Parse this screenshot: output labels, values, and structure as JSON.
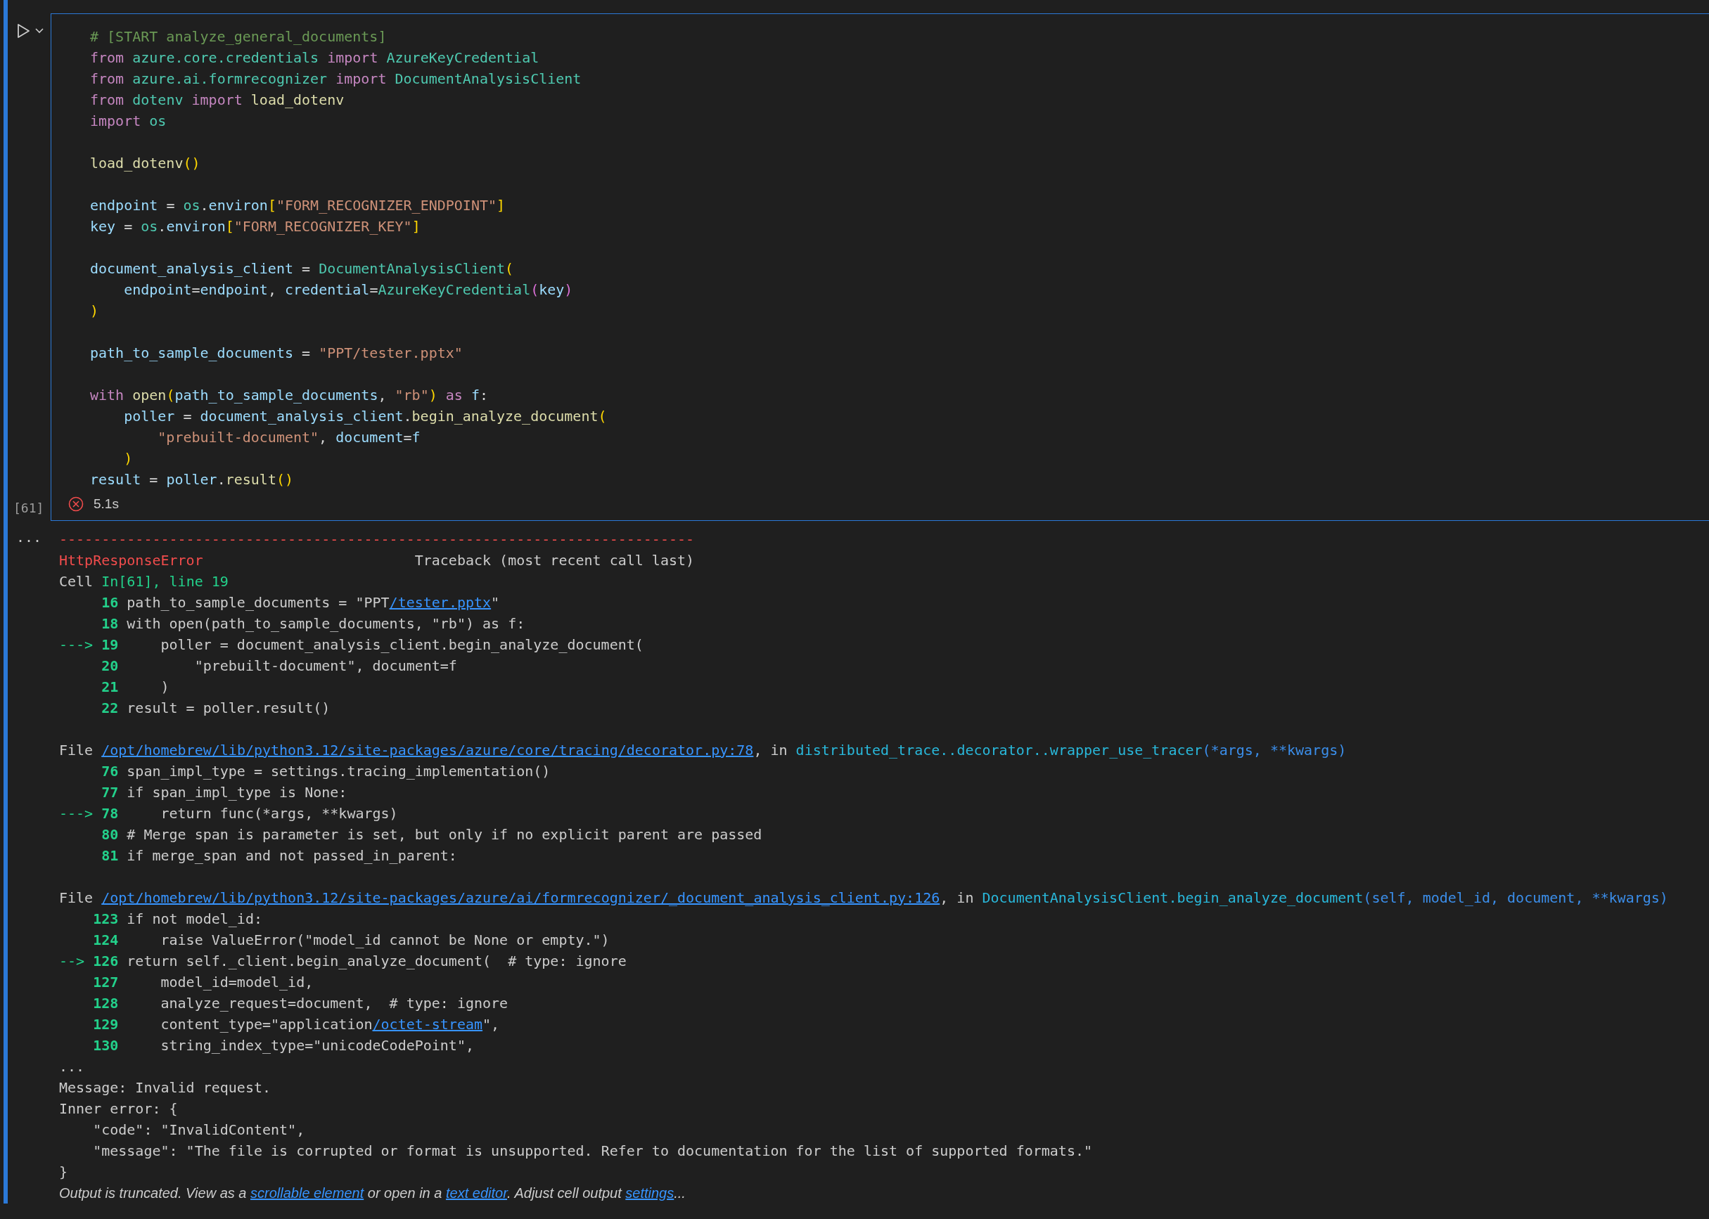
{
  "cell": {
    "execution_count": "[61]",
    "failed": true,
    "duration": "5.1s",
    "code_blocks": [
      [
        [
          {
            "kind": "comment",
            "text": "# [START analyze_general_documents]"
          }
        ],
        [
          {
            "kind": "kw",
            "text": "from "
          },
          {
            "kind": "mod",
            "text": "azure.core.credentials "
          },
          {
            "kind": "kw",
            "text": "import "
          },
          {
            "kind": "cls",
            "text": "AzureKeyCredential"
          }
        ],
        [
          {
            "kind": "kw",
            "text": "from "
          },
          {
            "kind": "mod",
            "text": "azure.ai.formrecognizer "
          },
          {
            "kind": "kw",
            "text": "import "
          },
          {
            "kind": "cls",
            "text": "DocumentAnalysisClient"
          }
        ],
        [
          {
            "kind": "kw",
            "text": "from "
          },
          {
            "kind": "mod",
            "text": "dotenv "
          },
          {
            "kind": "kw",
            "text": "import "
          },
          {
            "kind": "fn",
            "text": "load_dotenv"
          }
        ],
        [
          {
            "kind": "kw",
            "text": "import "
          },
          {
            "kind": "mod",
            "text": "os"
          }
        ]
      ],
      [
        [
          {
            "kind": "fn",
            "text": "load_dotenv"
          },
          {
            "kind": "br",
            "text": "()"
          }
        ]
      ],
      [
        [
          {
            "kind": "var",
            "text": "endpoint "
          },
          {
            "kind": "p",
            "text": "= "
          },
          {
            "kind": "mod",
            "text": "os"
          },
          {
            "kind": "p",
            "text": "."
          },
          {
            "kind": "var",
            "text": "environ"
          },
          {
            "kind": "br",
            "text": "["
          },
          {
            "kind": "str",
            "text": "\"FORM_RECOGNIZER_ENDPOINT\""
          },
          {
            "kind": "br",
            "text": "]"
          }
        ],
        [
          {
            "kind": "var",
            "text": "key "
          },
          {
            "kind": "p",
            "text": "= "
          },
          {
            "kind": "mod",
            "text": "os"
          },
          {
            "kind": "p",
            "text": "."
          },
          {
            "kind": "var",
            "text": "environ"
          },
          {
            "kind": "br",
            "text": "["
          },
          {
            "kind": "str",
            "text": "\"FORM_RECOGNIZER_KEY\""
          },
          {
            "kind": "br",
            "text": "]"
          }
        ]
      ],
      [
        [
          {
            "kind": "var",
            "text": "document_analysis_client "
          },
          {
            "kind": "p",
            "text": "= "
          },
          {
            "kind": "cls",
            "text": "DocumentAnalysisClient"
          },
          {
            "kind": "br",
            "text": "("
          }
        ],
        [
          {
            "kind": "var",
            "text": "    endpoint"
          },
          {
            "kind": "p",
            "text": "="
          },
          {
            "kind": "var",
            "text": "endpoint"
          },
          {
            "kind": "p",
            "text": ", "
          },
          {
            "kind": "var",
            "text": "credential"
          },
          {
            "kind": "p",
            "text": "="
          },
          {
            "kind": "cls",
            "text": "AzureKeyCredential"
          },
          {
            "kind": "br2",
            "text": "("
          },
          {
            "kind": "var",
            "text": "key"
          },
          {
            "kind": "br2",
            "text": ")"
          }
        ],
        [
          {
            "kind": "br",
            "text": ")"
          }
        ]
      ],
      [
        [
          {
            "kind": "var",
            "text": "path_to_sample_documents "
          },
          {
            "kind": "p",
            "text": "= "
          },
          {
            "kind": "str",
            "text": "\"PPT/tester.pptx\""
          }
        ]
      ],
      [
        [
          {
            "kind": "kw",
            "text": "with "
          },
          {
            "kind": "fn",
            "text": "open"
          },
          {
            "kind": "br",
            "text": "("
          },
          {
            "kind": "var",
            "text": "path_to_sample_documents"
          },
          {
            "kind": "p",
            "text": ", "
          },
          {
            "kind": "str",
            "text": "\"rb\""
          },
          {
            "kind": "br",
            "text": ")"
          },
          {
            "kind": "kw",
            "text": " as "
          },
          {
            "kind": "var",
            "text": "f"
          },
          {
            "kind": "p",
            "text": ":"
          }
        ],
        [
          {
            "kind": "var",
            "text": "    poller "
          },
          {
            "kind": "p",
            "text": "= "
          },
          {
            "kind": "var",
            "text": "document_analysis_client"
          },
          {
            "kind": "p",
            "text": "."
          },
          {
            "kind": "fn",
            "text": "begin_analyze_document"
          },
          {
            "kind": "br",
            "text": "("
          }
        ],
        [
          {
            "kind": "str",
            "text": "        \"prebuilt-document\""
          },
          {
            "kind": "p",
            "text": ", "
          },
          {
            "kind": "var",
            "text": "document"
          },
          {
            "kind": "p",
            "text": "="
          },
          {
            "kind": "var",
            "text": "f"
          }
        ],
        [
          {
            "kind": "br",
            "text": "    )"
          }
        ],
        [
          {
            "kind": "var",
            "text": "result "
          },
          {
            "kind": "p",
            "text": "= "
          },
          {
            "kind": "var",
            "text": "poller"
          },
          {
            "kind": "p",
            "text": "."
          },
          {
            "kind": "fn",
            "text": "result"
          },
          {
            "kind": "br",
            "text": "()"
          }
        ]
      ]
    ]
  },
  "output": {
    "menu": "...",
    "lines": [
      {
        "kind": "rule",
        "text": "---------------------------------------------------------------------------"
      },
      {
        "kind": "header",
        "error": "HttpResponseError",
        "title": "Traceback (most recent call last)"
      },
      {
        "kind": "text",
        "tokens": [
          {
            "kind": "plain",
            "text": "Cell "
          },
          {
            "kind": "green",
            "text": "In[61], line 19"
          }
        ]
      },
      {
        "kind": "src",
        "num": "16",
        "tokens": [
          {
            "kind": "plain",
            "text": "path_to_sample_documents = \"PPT"
          },
          {
            "kind": "link",
            "text": "/tester.pptx"
          },
          {
            "kind": "plain",
            "text": "\""
          }
        ]
      },
      {
        "kind": "src",
        "num": "18",
        "tokens": [
          {
            "kind": "plain",
            "text": "with open(path_to_sample_documents, \"rb\") as f:"
          }
        ]
      },
      {
        "kind": "src",
        "arrow": "--->",
        "num": "19",
        "tokens": [
          {
            "kind": "plain",
            "text": "    poller = document_analysis_client.begin_analyze_document("
          }
        ]
      },
      {
        "kind": "src",
        "num": "20",
        "tokens": [
          {
            "kind": "plain",
            "text": "        \"prebuilt-document\", document=f"
          }
        ]
      },
      {
        "kind": "src",
        "num": "21",
        "tokens": [
          {
            "kind": "plain",
            "text": "    )"
          }
        ]
      },
      {
        "kind": "src",
        "num": "22",
        "tokens": [
          {
            "kind": "plain",
            "text": "result = poller.result()"
          }
        ]
      },
      {
        "kind": "blank"
      },
      {
        "kind": "text",
        "tokens": [
          {
            "kind": "plain",
            "text": "File "
          },
          {
            "kind": "link",
            "text": "/opt/homebrew/lib/python3.12/site-packages/azure/core/tracing/decorator.py:78"
          },
          {
            "kind": "plain",
            "text": ", in "
          },
          {
            "kind": "cyan",
            "text": "distributed_trace..decorator..wrapper_use_tracer"
          },
          {
            "kind": "blue",
            "text": "(*args, **kwargs)"
          }
        ]
      },
      {
        "kind": "src",
        "num": "76",
        "tokens": [
          {
            "kind": "plain",
            "text": "span_impl_type = settings.tracing_implementation()"
          }
        ]
      },
      {
        "kind": "src",
        "num": "77",
        "tokens": [
          {
            "kind": "plain",
            "text": "if span_impl_type is None:"
          }
        ]
      },
      {
        "kind": "src",
        "arrow": "--->",
        "num": "78",
        "tokens": [
          {
            "kind": "plain",
            "text": "    return func(*args, **kwargs)"
          }
        ]
      },
      {
        "kind": "src",
        "num": "80",
        "tokens": [
          {
            "kind": "plain",
            "text": "# Merge span is parameter is set, but only if no explicit parent are passed"
          }
        ]
      },
      {
        "kind": "src",
        "num": "81",
        "tokens": [
          {
            "kind": "plain",
            "text": "if merge_span and not passed_in_parent:"
          }
        ]
      },
      {
        "kind": "blank"
      },
      {
        "kind": "text",
        "tokens": [
          {
            "kind": "plain",
            "text": "File "
          },
          {
            "kind": "link",
            "text": "/opt/homebrew/lib/python3.12/site-packages/azure/ai/formrecognizer/_document_analysis_client.py:126"
          },
          {
            "kind": "plain",
            "text": ", in "
          },
          {
            "kind": "cyan",
            "text": "DocumentAnalysisClient.begin_analyze_document"
          },
          {
            "kind": "blue",
            "text": "(self, model_id, document, **kwargs)"
          }
        ]
      },
      {
        "kind": "src",
        "num": "123",
        "tokens": [
          {
            "kind": "plain",
            "text": "if not model_id:"
          }
        ]
      },
      {
        "kind": "src",
        "num": "124",
        "tokens": [
          {
            "kind": "plain",
            "text": "    raise ValueError(\"model_id cannot be None or empty.\")"
          }
        ]
      },
      {
        "kind": "src",
        "arrow": "-->",
        "num": "126",
        "tokens": [
          {
            "kind": "plain",
            "text": "return self._client.begin_analyze_document(  # type: ignore"
          }
        ]
      },
      {
        "kind": "src",
        "num": "127",
        "tokens": [
          {
            "kind": "plain",
            "text": "    model_id=model_id,"
          }
        ]
      },
      {
        "kind": "src",
        "num": "128",
        "tokens": [
          {
            "kind": "plain",
            "text": "    analyze_request=document,  # type: ignore"
          }
        ]
      },
      {
        "kind": "src",
        "num": "129",
        "tokens": [
          {
            "kind": "plain",
            "text": "    content_type=\"application"
          },
          {
            "kind": "link",
            "text": "/octet-stream"
          },
          {
            "kind": "plain",
            "text": "\","
          }
        ]
      },
      {
        "kind": "src",
        "num": "130",
        "tokens": [
          {
            "kind": "plain",
            "text": "    string_index_type=\"unicodeCodePoint\","
          }
        ]
      },
      {
        "kind": "text",
        "tokens": [
          {
            "kind": "plain",
            "text": "..."
          }
        ]
      },
      {
        "kind": "text",
        "tokens": [
          {
            "kind": "plain",
            "text": "Message: Invalid request."
          }
        ]
      },
      {
        "kind": "text",
        "tokens": [
          {
            "kind": "plain",
            "text": "Inner error: {"
          }
        ]
      },
      {
        "kind": "text",
        "tokens": [
          {
            "kind": "plain",
            "text": "    \"code\": \"InvalidContent\","
          }
        ]
      },
      {
        "kind": "text",
        "tokens": [
          {
            "kind": "plain",
            "text": "    \"message\": \"The file is corrupted or format is unsupported. Refer to documentation for the list of supported formats.\""
          }
        ]
      },
      {
        "kind": "text",
        "tokens": [
          {
            "kind": "plain",
            "text": "}"
          }
        ]
      },
      {
        "kind": "note",
        "tokens": [
          {
            "kind": "plain",
            "text": "Output is truncated. View as a "
          },
          {
            "kind": "link",
            "text": "scrollable element"
          },
          {
            "kind": "plain",
            "text": " or open in a "
          },
          {
            "kind": "link",
            "text": "text editor"
          },
          {
            "kind": "plain",
            "text": ". Adjust cell output "
          },
          {
            "kind": "link",
            "text": "settings"
          },
          {
            "kind": "plain",
            "text": "..."
          }
        ]
      }
    ]
  }
}
